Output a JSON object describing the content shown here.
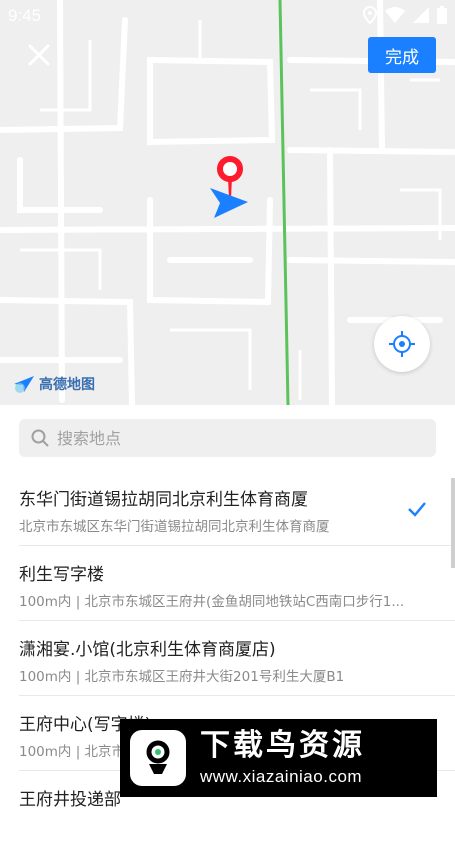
{
  "status_bar": {
    "time": "9:45"
  },
  "map": {
    "provider_logo_text": "高德地图",
    "accent_color": "#1a80ff",
    "pin_color": "#ff1a2e"
  },
  "header": {
    "done_label": "完成"
  },
  "search": {
    "placeholder": "搜索地点",
    "value": ""
  },
  "places": [
    {
      "title": "东华门街道锡拉胡同北京利生体育商厦",
      "subtitle": "北京市东城区东华门街道锡拉胡同北京利生体育商厦",
      "selected": true
    },
    {
      "title": "利生写字楼",
      "subtitle": "100m内 | 北京市东城区王府井(金鱼胡同地铁站C西南口步行1..."
    },
    {
      "title": "潇湘宴.小馆(北京利生体育商厦店)",
      "subtitle": "100m内 | 北京市东城区王府井大街201号利生大厦B1"
    },
    {
      "title": "王府中心(写字楼)",
      "subtitle": "100m内 | 北京市"
    },
    {
      "title": "王府井投递部",
      "subtitle": ""
    }
  ],
  "watermark": {
    "title": "下载鸟资源",
    "url": "www.xiazainiao.com"
  }
}
